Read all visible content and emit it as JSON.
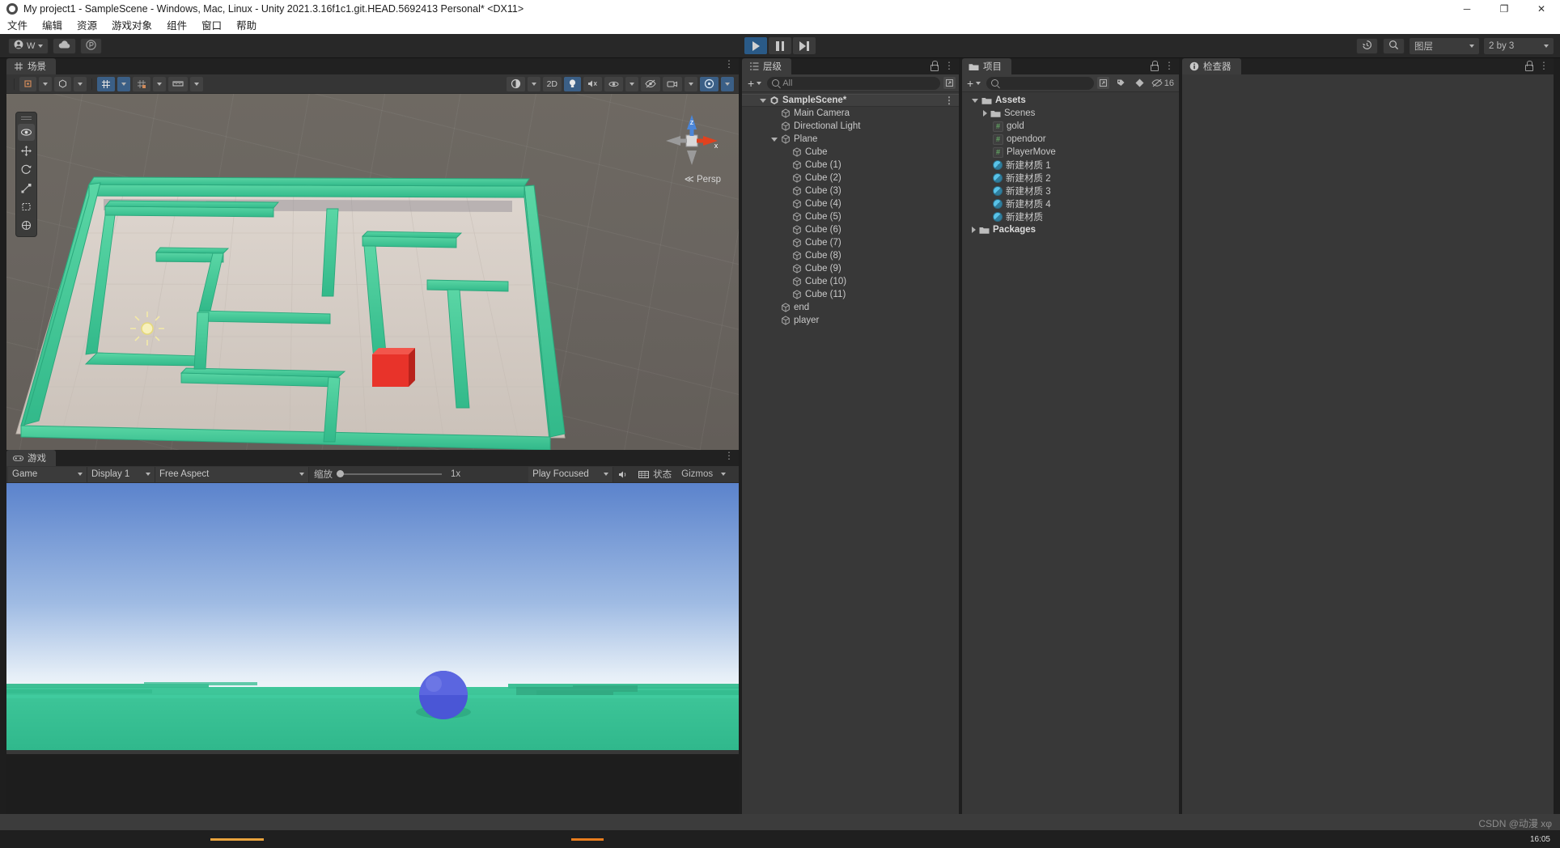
{
  "window": {
    "title": "My project1 - SampleScene - Windows, Mac, Linux - Unity 2021.3.16f1c1.git.HEAD.5692413 Personal* <DX11>",
    "app_icon": "unity-icon",
    "minimize": "─",
    "maximize": "❐",
    "close": "✕"
  },
  "menubar": {
    "items": [
      {
        "label": "文件"
      },
      {
        "label": "编辑"
      },
      {
        "label": "资源"
      },
      {
        "label": "游戏对象"
      },
      {
        "label": "组件"
      },
      {
        "label": "窗口"
      },
      {
        "label": "帮助"
      }
    ]
  },
  "toolbar": {
    "account_label": "W",
    "cloud_icon": "cloud-icon",
    "collab_icon": "collab-icon",
    "play_icon": "play-icon",
    "pause_icon": "pause-icon",
    "step_icon": "step-icon",
    "play_active": true,
    "history_icon": "history-icon",
    "search_icon": "search-icon",
    "layers_label": "图层",
    "layout_label": "2 by 3"
  },
  "scene": {
    "tab_label": "场景",
    "tab_icon": "grid-icon",
    "toolbar": {
      "tool_shading": "shading-icon",
      "tool_pivot": "pivot-icon",
      "tool_grid": "grid-snap-icon",
      "tool_snap": "snap-increment-icon",
      "tool_ruler": "ruler-icon",
      "draw_mode": "shaded-icon",
      "btn_2d": "2D",
      "light_icon": "light-icon",
      "audio_icon": "audio-mute-icon",
      "fx_icon": "effects-icon",
      "hidden_icon": "hidden-objects-icon",
      "camera_icon": "scene-camera-icon",
      "gizmos_icon": "gizmos-icon"
    },
    "left_tools": [
      {
        "name": "view-tool",
        "glyph": "✋",
        "active": true
      },
      {
        "name": "move-tool",
        "glyph": "✥",
        "active": false
      },
      {
        "name": "rotate-tool",
        "glyph": "⟳",
        "active": false
      },
      {
        "name": "scale-tool",
        "glyph": "⤡",
        "active": false
      },
      {
        "name": "rect-tool",
        "glyph": "⬚",
        "active": false
      },
      {
        "name": "transform-tool",
        "glyph": "✲",
        "active": false
      }
    ],
    "gizmo": {
      "axis_y_label": "z",
      "axis_x_label": "x",
      "persp_label": "Persp",
      "persp_prefix": "≪"
    }
  },
  "game": {
    "tab_label": "游戏",
    "tab_icon": "gamepad-icon",
    "target_display": "Game",
    "display_label": "Display 1",
    "aspect_label": "Free Aspect",
    "scale_label": "缩放",
    "scale_value": "1x",
    "scale_percent": 0,
    "play_focused": "Play Focused",
    "mute_icon": "audio-icon",
    "stats_icon": "stats-grid-icon",
    "stats_label": "状态",
    "gizmos_label": "Gizmos"
  },
  "hierarchy": {
    "tab_label": "层级",
    "tab_icon": "hierarchy-icon",
    "add_label": "+",
    "search_placeholder": "All",
    "search_value": "",
    "items": [
      {
        "label": "SampleScene*",
        "depth": 0,
        "icon": "unity-scene-icon",
        "expanded": true,
        "is_scene": true
      },
      {
        "label": "Main Camera",
        "depth": 1,
        "icon": "gameobject-icon",
        "expanded": null
      },
      {
        "label": "Directional Light",
        "depth": 1,
        "icon": "gameobject-icon",
        "expanded": null
      },
      {
        "label": "Plane",
        "depth": 1,
        "icon": "gameobject-icon",
        "expanded": true
      },
      {
        "label": "Cube",
        "depth": 2,
        "icon": "gameobject-icon",
        "expanded": null
      },
      {
        "label": "Cube (1)",
        "depth": 2,
        "icon": "gameobject-icon",
        "expanded": null
      },
      {
        "label": "Cube (2)",
        "depth": 2,
        "icon": "gameobject-icon",
        "expanded": null
      },
      {
        "label": "Cube (3)",
        "depth": 2,
        "icon": "gameobject-icon",
        "expanded": null
      },
      {
        "label": "Cube (4)",
        "depth": 2,
        "icon": "gameobject-icon",
        "expanded": null
      },
      {
        "label": "Cube (5)",
        "depth": 2,
        "icon": "gameobject-icon",
        "expanded": null
      },
      {
        "label": "Cube (6)",
        "depth": 2,
        "icon": "gameobject-icon",
        "expanded": null
      },
      {
        "label": "Cube (7)",
        "depth": 2,
        "icon": "gameobject-icon",
        "expanded": null
      },
      {
        "label": "Cube (8)",
        "depth": 2,
        "icon": "gameobject-icon",
        "expanded": null
      },
      {
        "label": "Cube (9)",
        "depth": 2,
        "icon": "gameobject-icon",
        "expanded": null
      },
      {
        "label": "Cube (10)",
        "depth": 2,
        "icon": "gameobject-icon",
        "expanded": null
      },
      {
        "label": "Cube (11)",
        "depth": 2,
        "icon": "gameobject-icon",
        "expanded": null
      },
      {
        "label": "end",
        "depth": 1,
        "icon": "gameobject-icon",
        "expanded": null
      },
      {
        "label": "player",
        "depth": 1,
        "icon": "gameobject-icon",
        "expanded": null
      }
    ]
  },
  "project": {
    "tab_label": "项目",
    "tab_icon": "folder-icon",
    "add_label": "+",
    "search_placeholder": "",
    "search_value": "",
    "favorite_icon": "favorite-icon",
    "label_icon": "label-icon",
    "hidden_icon": "hidden-icon",
    "hidden_count": "16",
    "items": [
      {
        "label": "Assets",
        "depth": 0,
        "icon": "folder-icon",
        "expanded": true,
        "bold": true
      },
      {
        "label": "Scenes",
        "depth": 1,
        "icon": "folder-icon",
        "expanded": false
      },
      {
        "label": "gold",
        "depth": 1,
        "icon": "script-icon"
      },
      {
        "label": "opendoor",
        "depth": 1,
        "icon": "script-icon"
      },
      {
        "label": "PlayerMove",
        "depth": 1,
        "icon": "script-icon"
      },
      {
        "label": "新建材质 1",
        "depth": 1,
        "icon": "material-icon"
      },
      {
        "label": "新建材质 2",
        "depth": 1,
        "icon": "material-icon"
      },
      {
        "label": "新建材质 3",
        "depth": 1,
        "icon": "material-icon"
      },
      {
        "label": "新建材质 4",
        "depth": 1,
        "icon": "material-icon"
      },
      {
        "label": "新建材质",
        "depth": 1,
        "icon": "material-icon"
      },
      {
        "label": "Packages",
        "depth": 0,
        "icon": "folder-icon",
        "expanded": false,
        "bold": true
      }
    ]
  },
  "inspector": {
    "tab_label": "检查器",
    "tab_icon": "info-icon"
  },
  "statusbar": {
    "text": ""
  },
  "watermark": {
    "text": "CSDN @动漫 xφ"
  },
  "taskbar": {
    "clock": "16:05"
  },
  "colors": {
    "accent_blue": "#2a5a87",
    "maze_green": "#3fc79a",
    "floor": "#d7cfc8",
    "player_blue": "#4a56d6",
    "goal_red": "#e8332a",
    "sky_top": "#6f8fd0",
    "panel_bg": "#383838",
    "toolbar_bg": "#282828"
  }
}
